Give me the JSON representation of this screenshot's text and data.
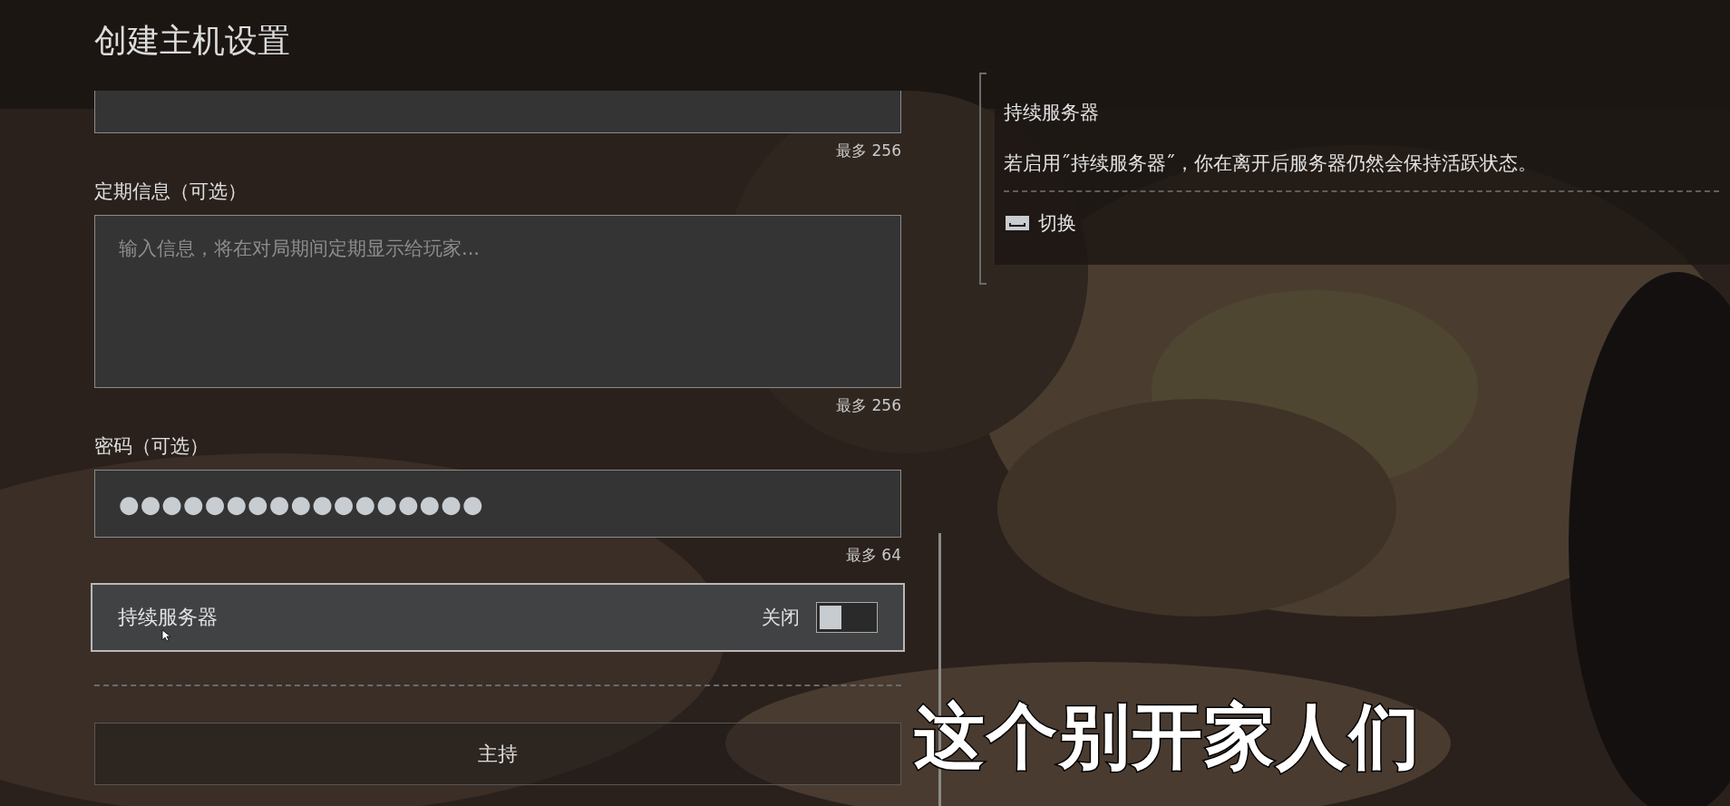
{
  "title": "创建主机设置",
  "fields": [
    {
      "kind": "cut",
      "counter": "最多 256"
    },
    {
      "kind": "textarea",
      "label": "定期信息（可选）",
      "placeholder": "输入信息，将在对局期间定期显示给玩家...",
      "counter": "最多 256"
    },
    {
      "kind": "password",
      "label": "密码（可选）",
      "value": "●●●●●●●●●●●●●●●●●",
      "counter": "最多 64"
    }
  ],
  "toggle_row": {
    "label": "持续服务器",
    "state_text": "关闭",
    "on": false
  },
  "host_button": "主持",
  "help_panel": {
    "title": "持续服务器",
    "description": "若启用˝持续服务器˝，你在离开后服务器仍然会保持活跃状态。",
    "action": "切换"
  },
  "subtitle": "这个别开家人们"
}
